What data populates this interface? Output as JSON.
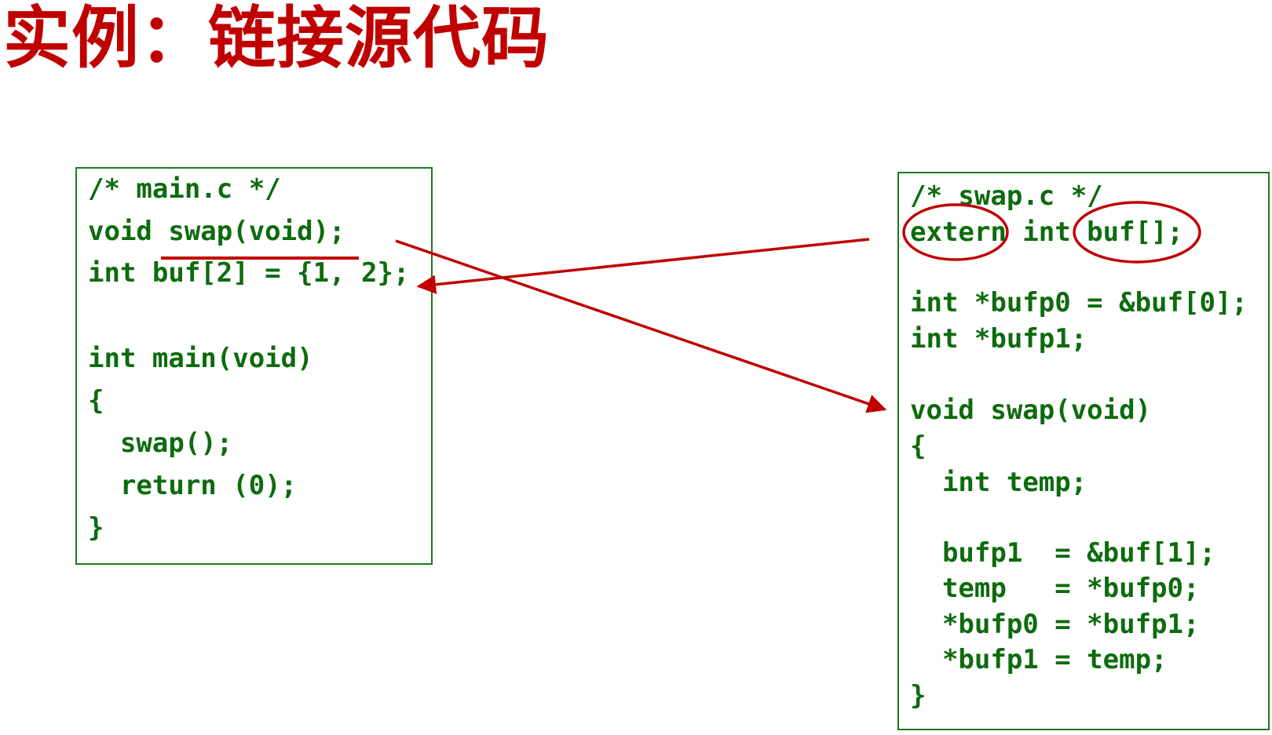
{
  "slide": {
    "title": "实例：链接源代码",
    "accent_color": "#c00000",
    "code_color": "#0d6b0d",
    "box_border_color": "#1e7b1e"
  },
  "main_c": {
    "lines": [
      "/* main.c */",
      "void swap(void);",
      "int buf[2] = {1, 2};",
      "int main(void)",
      "{",
      "  swap();",
      "  return (0);",
      "}"
    ]
  },
  "swap_c": {
    "lines": [
      "/* swap.c */",
      "extern int buf[];",
      "int *bufp0 = &buf[0];",
      "int *bufp1;",
      "void swap(void)",
      "{",
      "  int temp;",
      "  bufp1  = &buf[1];",
      "  temp   = *bufp0;",
      "  *bufp0 = *bufp1;",
      "  *bufp1 = temp;",
      "}"
    ]
  },
  "annotations": {
    "underline_target": "swap(void);",
    "circled_tokens": [
      "extern",
      "buf[];"
    ]
  }
}
